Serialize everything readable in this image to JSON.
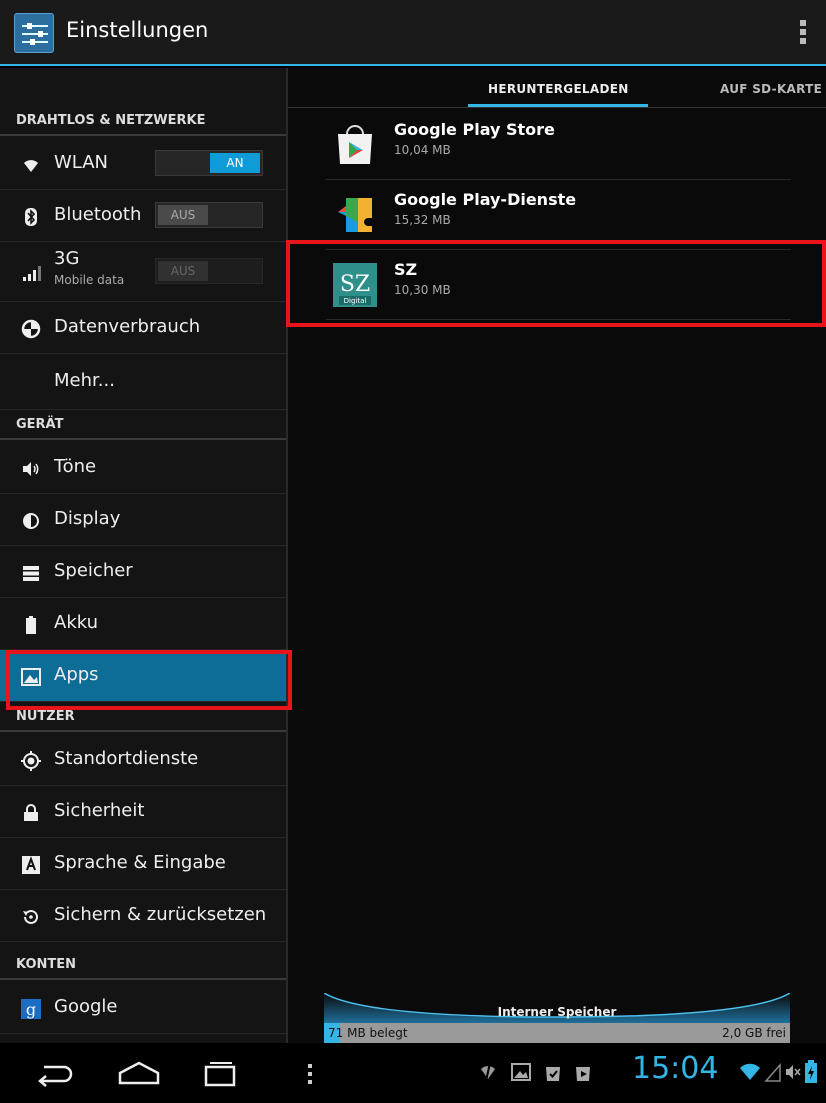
{
  "actionbar": {
    "title": "Einstellungen"
  },
  "sidebar": {
    "categories": [
      "DRAHTLOS & NETZWERKE",
      "GERÄT",
      "NUTZER",
      "KONTEN"
    ],
    "wlan": {
      "label": "WLAN",
      "toggle": "AN"
    },
    "bluetooth": {
      "label": "Bluetooth",
      "toggle": "AUS"
    },
    "mobile": {
      "label": "3G",
      "sub": "Mobile data",
      "toggle": "AUS"
    },
    "items": {
      "datenverbrauch": "Datenverbrauch",
      "mehr": "Mehr...",
      "toene": "Töne",
      "display": "Display",
      "speicher": "Speicher",
      "akku": "Akku",
      "apps": "Apps",
      "standort": "Standortdienste",
      "sicherheit": "Sicherheit",
      "sprache": "Sprache & Eingabe",
      "sichern": "Sichern & zurücksetzen",
      "google": "Google"
    }
  },
  "tabs": [
    "HERUNTERGELADEN",
    "AUF SD-KARTE"
  ],
  "apps": [
    {
      "name": "Google Play Store",
      "size": "10,04 MB"
    },
    {
      "name": "Google Play-Dienste",
      "size": "15,32 MB"
    },
    {
      "name": "SZ",
      "size": "10,30 MB"
    }
  ],
  "sz_icon": {
    "letters": "SZ",
    "caption": "Digital"
  },
  "storage": {
    "title": "Interner Speicher",
    "used": "71 MB belegt",
    "free": "2,0 GB frei",
    "used_fraction": 0.034
  },
  "statusbar": {
    "time": "15:04"
  },
  "colors": {
    "accent": "#33b5e5",
    "highlight": "#e8141a",
    "selected": "#0e6d96"
  }
}
